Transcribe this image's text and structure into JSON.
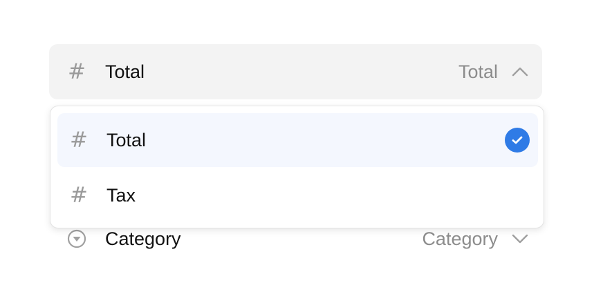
{
  "selected_field": {
    "name": "Total",
    "value": "Total",
    "icon": "hash-icon",
    "chevron": "chevron-up-icon"
  },
  "dropdown": {
    "options": [
      {
        "label": "Total",
        "icon": "hash-icon",
        "selected": true
      },
      {
        "label": "Tax",
        "icon": "hash-icon",
        "selected": false
      }
    ]
  },
  "next_field": {
    "name": "Category",
    "value": "Category",
    "icon": "dropdown-circle-icon",
    "chevron": "chevron-down-icon"
  },
  "colors": {
    "accent": "#2f7be6",
    "selected_row_bg": "#f4f7fe",
    "open_row_bg": "#f3f3f3"
  },
  "glyphs": {
    "hash": "#"
  }
}
